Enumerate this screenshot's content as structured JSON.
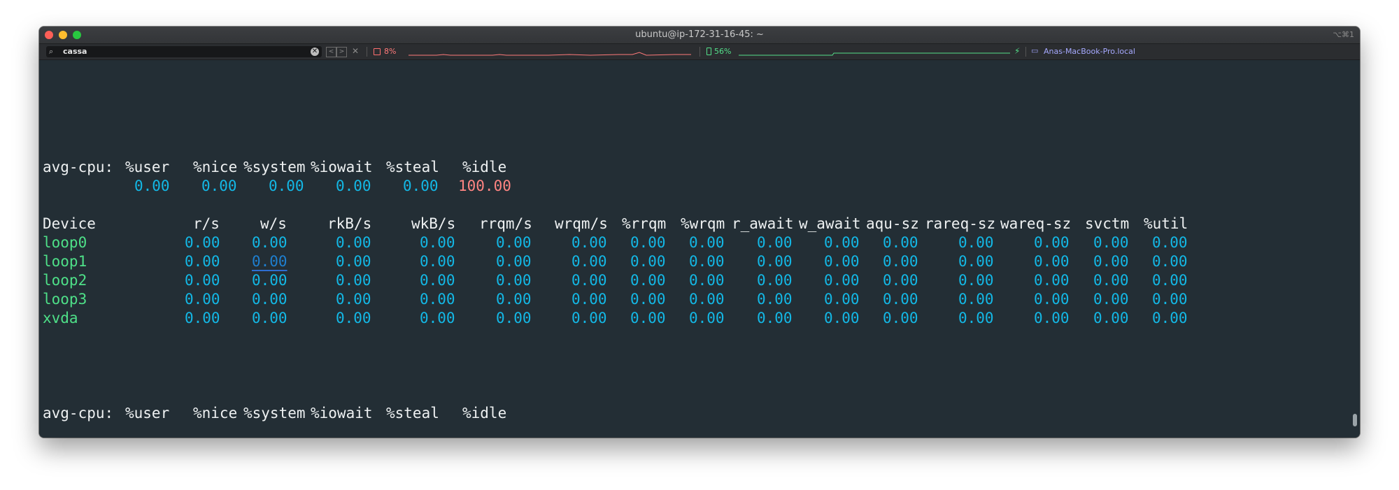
{
  "window": {
    "title": "ubuntu@ip-172-31-16-45: ~",
    "shortcut": "⌥⌘1"
  },
  "statusbar": {
    "search_value": "cassa",
    "cpu_percent": "8%",
    "battery_percent": "56%",
    "hostname": "Anas-MacBook-Pro.local",
    "colors": {
      "cpu": "#ff7a7a",
      "battery": "#54e08a",
      "host": "#a6a9ff"
    }
  },
  "iostat": {
    "cpu_header": [
      "avg-cpu:",
      "%user",
      "%nice",
      "%system",
      "%iowait",
      "%steal",
      "%idle"
    ],
    "cpu_values": [
      "0.00",
      "0.00",
      "0.00",
      "0.00",
      "0.00",
      "100.00"
    ],
    "device_header": [
      "Device",
      "r/s",
      "w/s",
      "rkB/s",
      "wkB/s",
      "rrqm/s",
      "wrqm/s",
      "%rrqm",
      "%wrqm",
      "r_await",
      "w_await",
      "aqu-sz",
      "rareq-sz",
      "wareq-sz",
      "svctm",
      "%util"
    ],
    "devices": [
      {
        "name": "loop0",
        "values": [
          "0.00",
          "0.00",
          "0.00",
          "0.00",
          "0.00",
          "0.00",
          "0.00",
          "0.00",
          "0.00",
          "0.00",
          "0.00",
          "0.00",
          "0.00",
          "0.00",
          "0.00"
        ]
      },
      {
        "name": "loop1",
        "values": [
          "0.00",
          "0.00",
          "0.00",
          "0.00",
          "0.00",
          "0.00",
          "0.00",
          "0.00",
          "0.00",
          "0.00",
          "0.00",
          "0.00",
          "0.00",
          "0.00",
          "0.00"
        ]
      },
      {
        "name": "loop2",
        "values": [
          "0.00",
          "0.00",
          "0.00",
          "0.00",
          "0.00",
          "0.00",
          "0.00",
          "0.00",
          "0.00",
          "0.00",
          "0.00",
          "0.00",
          "0.00",
          "0.00",
          "0.00"
        ]
      },
      {
        "name": "loop3",
        "values": [
          "0.00",
          "0.00",
          "0.00",
          "0.00",
          "0.00",
          "0.00",
          "0.00",
          "0.00",
          "0.00",
          "0.00",
          "0.00",
          "0.00",
          "0.00",
          "0.00",
          "0.00"
        ]
      },
      {
        "name": "xvda",
        "values": [
          "0.00",
          "0.00",
          "0.00",
          "0.00",
          "0.00",
          "0.00",
          "0.00",
          "0.00",
          "0.00",
          "0.00",
          "0.00",
          "0.00",
          "0.00",
          "0.00",
          "0.00"
        ]
      }
    ],
    "colors": {
      "value": "#13b8e6",
      "idle": "#ff8582",
      "device": "#4ee088",
      "text": "#eef1f2"
    }
  }
}
